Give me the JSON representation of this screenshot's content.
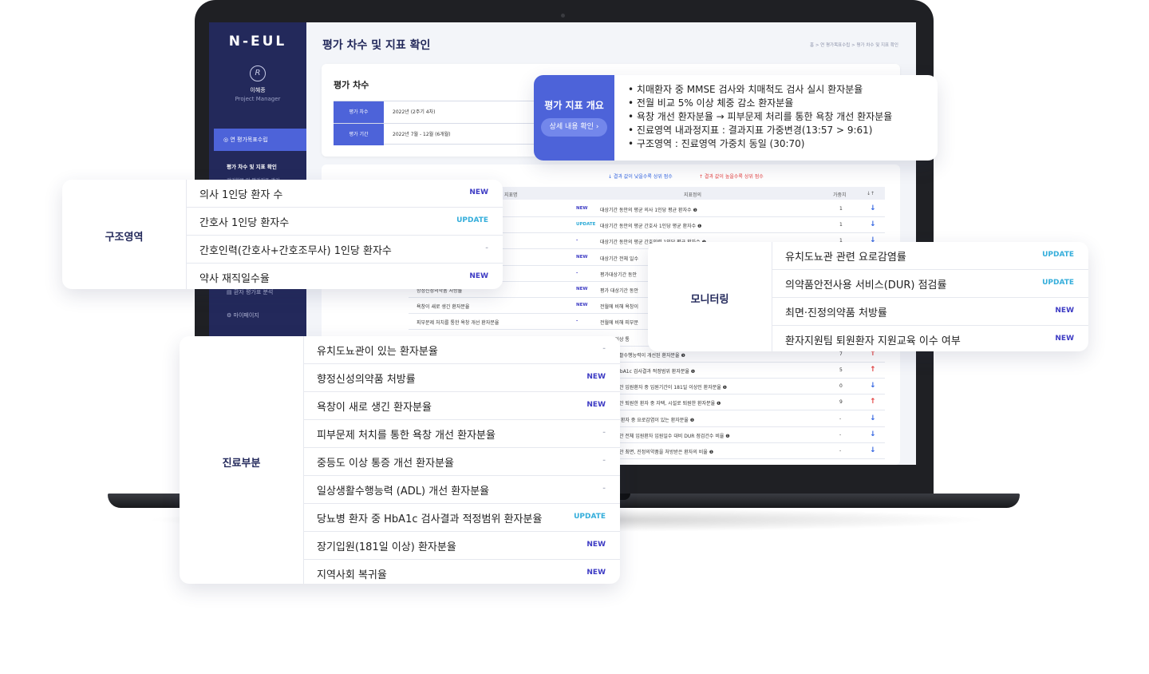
{
  "app": {
    "logo": "N-EUL",
    "user_name": "이혜종",
    "user_role": "Project Manager"
  },
  "sidebar": {
    "active": "연 평가목표수립",
    "sub_active": "평가 차수 및 지표 확인",
    "sub_next": "관리항목 및 평가지표 관리",
    "items": [
      {
        "label": "환자 평가표 분석"
      },
      {
        "label": "마이페이지"
      }
    ]
  },
  "header": {
    "title": "평가 차수 및 지표 확인",
    "breadcrumb": "홈 > 연 평가목표수립 > 평가 차수 및 지표 확인"
  },
  "round": {
    "title": "평가 차수",
    "rows": [
      {
        "key": "평가 차수",
        "value": "2022년 (2주기 4차)"
      },
      {
        "key": "평가 기간",
        "value": "2022년 7월 - 12월 (6개월)"
      }
    ]
  },
  "legend": {
    "low": "↓ 결과 값이 낮을수록 상위 점수",
    "high": "↑ 결과 값이 높을수록 상위 점수"
  },
  "table": {
    "headers": [
      "지표명",
      "",
      "지표정의",
      "가중치",
      "↓↑"
    ],
    "rows": [
      {
        "name": "",
        "badge": "NEW",
        "def": "대상기간 동안의 평균 의사 1인당 평균 환자수 ❶",
        "w": "1",
        "dir": "↓"
      },
      {
        "name": "",
        "badge": "UPDATE",
        "def": "대상기간 동안의 평균 간호사 1인당 평균 환자수 ❶",
        "w": "1",
        "dir": "↓"
      },
      {
        "name": "(간호사+간호조무사) 1인당 환자수",
        "badge": "-",
        "def": "대상기간 동안의 평균 간호인력 1인당 평균 환자수 ❶",
        "w": "1",
        "dir": "↓"
      },
      {
        "name": "",
        "badge": "NEW",
        "def": "대상기간 전체 일수",
        "w": "",
        "dir": ""
      },
      {
        "name": "",
        "badge": "-",
        "def": "평가대상기간 동안",
        "w": "",
        "dir": ""
      },
      {
        "name": "항정신성의약품 처방률",
        "badge": "NEW",
        "def": "평가 대상기간 동안",
        "w": "",
        "dir": ""
      },
      {
        "name": "욕창이 새로 생긴 환자분율",
        "badge": "NEW",
        "def": "전월에 비해 욕창이",
        "w": "",
        "dir": ""
      },
      {
        "name": "피부문제 처치를 통한 욕창 개선 환자분율",
        "badge": "-",
        "def": "전월에 비해 피부문",
        "w": "",
        "dir": ""
      },
      {
        "name": "",
        "badge": "",
        "def": "중증도 이상 통",
        "w": "",
        "dir": ""
      },
      {
        "name": "",
        "badge": "",
        "def": "해 일상생활수행능력이 개선된 환자분율 ❶",
        "w": "7",
        "dir": "↑"
      },
      {
        "name": "",
        "badge": "",
        "def": "환자 중 HbA1c 검사결과 적정범위 환자분율 ❶",
        "w": "5",
        "dir": "↑"
      },
      {
        "name": "",
        "badge": "",
        "def": "상기간 동안 입원환자 중 입원기간이 181일 이상인 환자분율 ❶",
        "w": "0",
        "dir": "↓"
      },
      {
        "name": "",
        "badge": "",
        "def": "상기간 동안 퇴원한 환자 중 자택, 시설로 퇴원한 환자분율 ❶",
        "w": "9",
        "dir": "↑"
      },
      {
        "name": "",
        "badge": "",
        "def": "관이 있는 환자 중 요로감염이 있는 환자분율 ❶",
        "w": "-",
        "dir": "↓"
      },
      {
        "name": "",
        "badge": "",
        "def": "상기간 동안 전체 입원환자 입원일수 대비 DUR 점검건수 비율 ❶",
        "w": "-",
        "dir": "↓"
      },
      {
        "name": "",
        "badge": "",
        "def": "상기간 동안 최면, 진정의약품을 처방받은 환자의 비율 ❶",
        "w": "-",
        "dir": "↓"
      }
    ]
  },
  "overview": {
    "title": "평가 지표 개요",
    "button": "상세 내용 확인  ›",
    "bullets": [
      "치매환자 중 MMSE 검사와 치매척도 검사 실시 환자분율",
      "전월 비교 5% 이상 체중 감소 환자분율",
      "욕창 개선 환자분율 → 피부문제 처리를 통한 욕창 개선 환자분율",
      "진료영역 내과정지표 : 결과지표 가중변경(13:57 > 9:61)",
      "구조영역 : 진료영역 가중치 동일 (30:70)"
    ]
  },
  "structure": {
    "label": "구조영역",
    "rows": [
      {
        "text": "의사 1인당 환자 수",
        "badge": "NEW"
      },
      {
        "text": "간호사 1인당 환자수",
        "badge": "UPDATE"
      },
      {
        "text": "간호인력(간호사+간호조무사) 1인당 환자수",
        "badge": "-"
      },
      {
        "text": "약사 재직일수율",
        "badge": "NEW"
      }
    ]
  },
  "monitoring": {
    "label": "모니터링",
    "rows": [
      {
        "text": "유치도뇨관 관련 요로감염률",
        "badge": "UPDATE"
      },
      {
        "text": "의약품안전사용 서비스(DUR) 점검률",
        "badge": "UPDATE"
      },
      {
        "text": "최면·진정의약품 처방률",
        "badge": "NEW"
      },
      {
        "text": "환자지원팀 퇴원환자 지원교육 이수 여부",
        "badge": "NEW"
      }
    ]
  },
  "clinical": {
    "label": "진료부분",
    "rows": [
      {
        "text": "유치도뇨관이 있는 환자분율",
        "badge": "-"
      },
      {
        "text": "향정신성의약품 처방률",
        "badge": "NEW"
      },
      {
        "text": "욕창이 새로 생긴 환자분율",
        "badge": "NEW"
      },
      {
        "text": "피부문제 처치를 통한 욕창 개선 환자분율",
        "badge": "-"
      },
      {
        "text": "중등도 이상 통증 개선 환자분율",
        "badge": "-"
      },
      {
        "text": "일상생활수행능력 (ADL) 개선 환자분율",
        "badge": "-"
      },
      {
        "text": "당뇨병 환자 중 HbA1c 검사결과 적정범위 환자분율",
        "badge": "UPDATE"
      },
      {
        "text": "장기입원(181일 이상) 환자분율",
        "badge": "NEW"
      },
      {
        "text": "지역사회 복귀율",
        "badge": "NEW"
      }
    ]
  },
  "colors": {
    "navy": "#23295b",
    "accent": "#4d63d9",
    "badge_new": "#3d3bc4",
    "badge_update": "#35aedb",
    "arrow_down": "#2f62e0",
    "arrow_up": "#e33b3b"
  }
}
